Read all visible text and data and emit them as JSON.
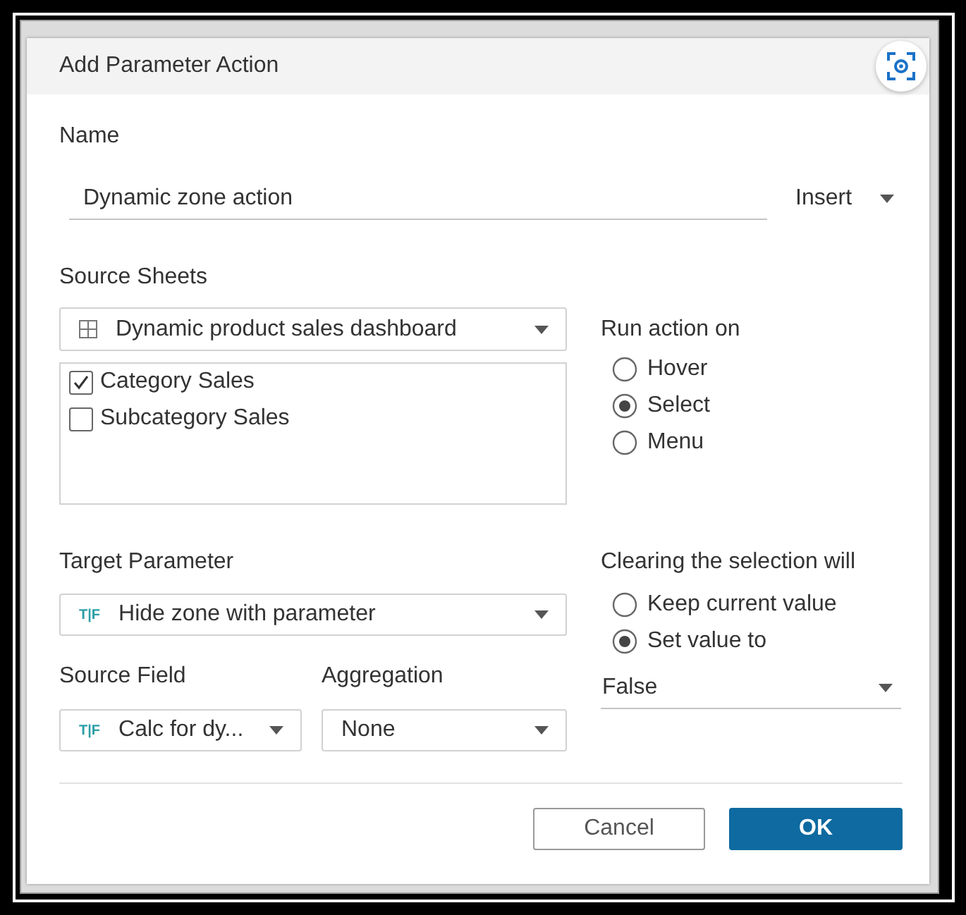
{
  "dialog": {
    "title": "Add Parameter Action"
  },
  "name": {
    "label": "Name",
    "value": "Dynamic zone action",
    "insert": "Insert"
  },
  "source_sheets": {
    "label": "Source Sheets",
    "dashboard": "Dynamic product sales dashboard",
    "sheets": [
      {
        "label": "Category Sales",
        "checked": true
      },
      {
        "label": "Subcategory Sales",
        "checked": false
      }
    ]
  },
  "run_action_on": {
    "label": "Run action on",
    "options": [
      {
        "label": "Hover",
        "selected": false
      },
      {
        "label": "Select",
        "selected": true
      },
      {
        "label": "Menu",
        "selected": false
      }
    ]
  },
  "target_parameter": {
    "label": "Target Parameter",
    "type": "T|F",
    "value": "Hide zone with parameter"
  },
  "source_field": {
    "label": "Source Field",
    "type": "T|F",
    "value": "Calc for dy..."
  },
  "aggregation": {
    "label": "Aggregation",
    "value": "None"
  },
  "clearing": {
    "label": "Clearing the selection will",
    "options": [
      {
        "label": "Keep current value",
        "selected": false
      },
      {
        "label": "Set value to",
        "selected": true
      }
    ],
    "value": "False"
  },
  "buttons": [
    {
      "label": "Cancel",
      "kind": "secondary"
    },
    {
      "label": "OK",
      "kind": "primary"
    }
  ]
}
